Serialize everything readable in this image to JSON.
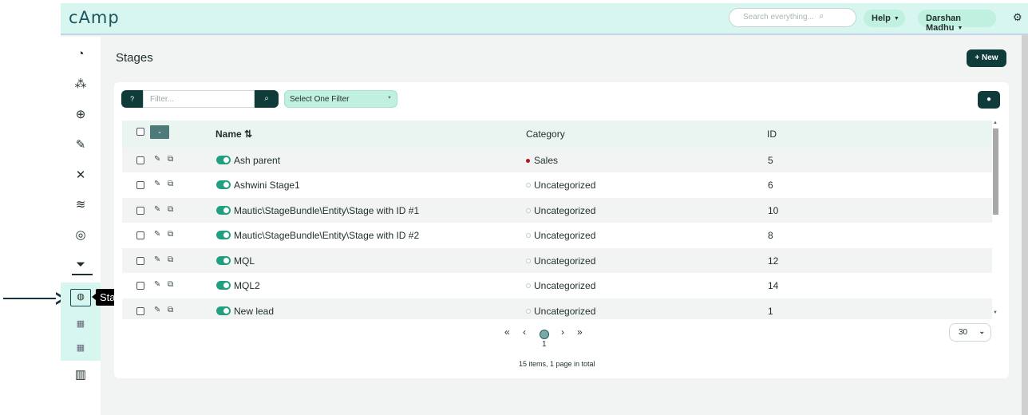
{
  "app": {
    "logo": "cAmp"
  },
  "topbar": {
    "search_placeholder": "Search everything...",
    "search_icon": "⌕",
    "help_label": "Help",
    "user_label": "Darshan Madhu",
    "caret": "▼",
    "gear_icon": "⚙"
  },
  "sidebar": {
    "icons": [
      {
        "name": "dashboard-gauge-icon",
        "glyph": "◔"
      },
      {
        "name": "contacts-network-icon",
        "glyph": "⁂"
      },
      {
        "name": "target-icon",
        "glyph": "⊕"
      },
      {
        "name": "forms-edit-icon",
        "glyph": "✎"
      },
      {
        "name": "nodes-icon",
        "glyph": "✕"
      },
      {
        "name": "routes-icon",
        "glyph": "≋"
      },
      {
        "name": "points-icon",
        "glyph": "◎"
      },
      {
        "name": "funnel-icon",
        "glyph": "⏷"
      },
      {
        "name": "stages-icon",
        "glyph": "◍"
      },
      {
        "name": "calculator-icon",
        "glyph": "▦"
      },
      {
        "name": "calculator-icon-2",
        "glyph": "▦"
      },
      {
        "name": "reports-chart-icon",
        "glyph": "▥"
      }
    ],
    "tooltip": "Stages"
  },
  "page": {
    "title": "Stages",
    "new_label": "+ New"
  },
  "toolbar": {
    "help_glyph": "?",
    "filter_placeholder": "Filter...",
    "search_glyph": "⌕",
    "select_label": "Select One Filter",
    "select_caret": "▼",
    "person_glyph": "●"
  },
  "table": {
    "header_drop": "⌄",
    "columns": {
      "name": "Name ⇅",
      "category": "Category",
      "id": "ID"
    },
    "rows": [
      {
        "name": "Ash parent",
        "category": "Sales",
        "category_color": "#b01818",
        "id": "5"
      },
      {
        "name": "Ashwini Stage1",
        "category": "Uncategorized",
        "category_color": "",
        "id": "6"
      },
      {
        "name": "Mautic\\StageBundle\\Entity\\Stage with ID #1",
        "category": "Uncategorized",
        "category_color": "",
        "id": "10"
      },
      {
        "name": "Mautic\\StageBundle\\Entity\\Stage with ID #2",
        "category": "Uncategorized",
        "category_color": "",
        "id": "8"
      },
      {
        "name": "MQL",
        "category": "Uncategorized",
        "category_color": "",
        "id": "12"
      },
      {
        "name": "MQL2",
        "category": "Uncategorized",
        "category_color": "",
        "id": "14"
      },
      {
        "name": "New lead",
        "category": "Uncategorized",
        "category_color": "",
        "id": "1"
      }
    ],
    "edit_glyph": "✎",
    "copy_glyph": "⧉"
  },
  "pagination": {
    "first": "«",
    "prev": "‹",
    "current_page": "1",
    "next": "›",
    "last": "»",
    "per_page": "30",
    "per_page_chev": "⌄",
    "summary": "15 items, 1 page in total"
  }
}
